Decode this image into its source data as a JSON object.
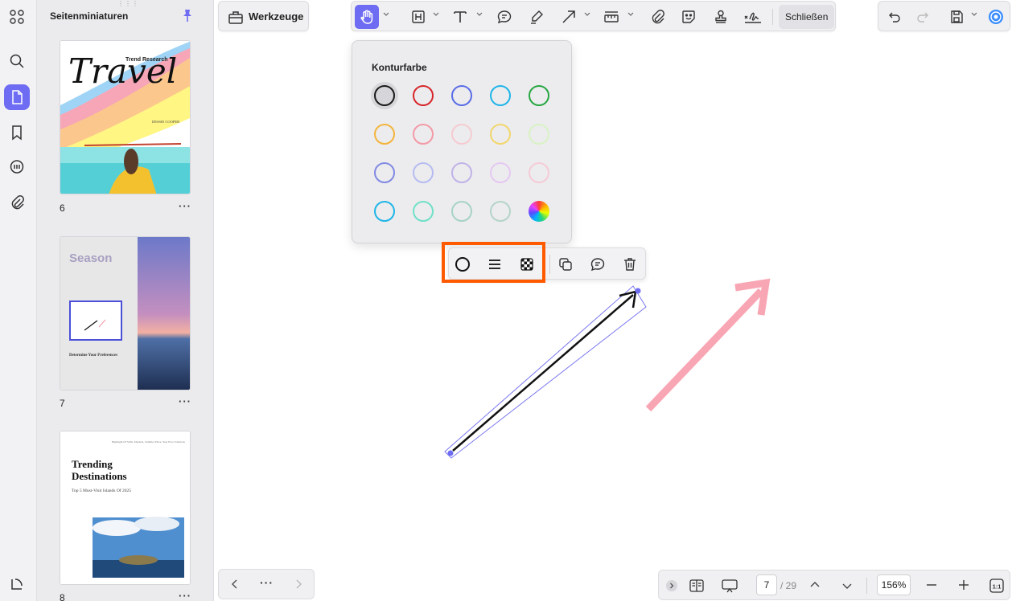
{
  "sidebar": {
    "title": "Seitenminiaturen",
    "pages": [
      {
        "number": "6",
        "title": "Travel",
        "subtitle": "Trend Research",
        "author": "DESSIE COOPER"
      },
      {
        "number": "7",
        "title": "Season",
        "heading": "Determine Your Preferences"
      },
      {
        "number": "8",
        "title": "Trending Destinations",
        "subtitle": "Top 5 Must-Visit Islands Of 2025",
        "tagline": "Highlight Of Stills, Markets, Summer Place, Year Ever Solutions"
      }
    ]
  },
  "toolbar": {
    "tools_label": "Werkzeuge",
    "close_label": "Schließen"
  },
  "color_popup": {
    "title": "Konturfarbe",
    "colors": [
      [
        "#1a1a1a",
        "#d7262b",
        "#5a6ce6",
        "#1fb5e8",
        "#27a642"
      ],
      [
        "#f3b43d",
        "#f39aa6",
        "#f5cbd1",
        "#f2d66c",
        "#d8f2c4"
      ],
      [
        "#8189e3",
        "#b6bcf1",
        "#c1b2e8",
        "#e5c8f1",
        "#f5cbd6"
      ],
      [
        "#1fb5e8",
        "#6fe0c7",
        "#a6d2c7",
        "#b4d4c8",
        "rainbow"
      ]
    ]
  },
  "pagination": {
    "current_page": "7",
    "total_pages": "/ 29"
  },
  "zoom": {
    "value": "156%"
  },
  "colors": {
    "accent": "#6d6cf2",
    "highlight": "#ff5a00",
    "pink_arrow": "#f9a6b4"
  }
}
